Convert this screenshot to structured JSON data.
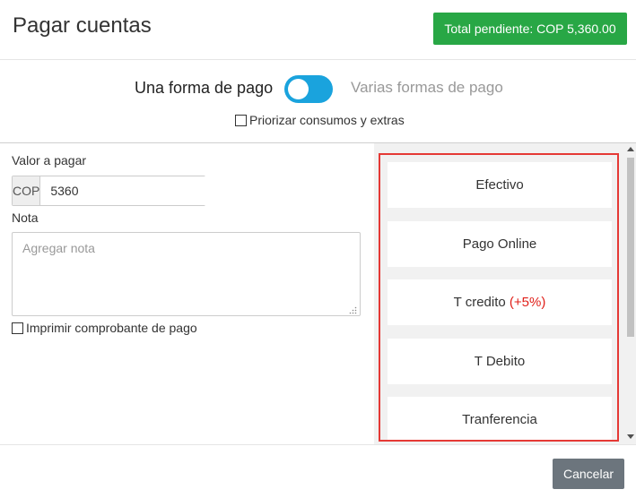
{
  "header": {
    "title": "Pagar cuentas",
    "total_pending": "Total pendiente: COP 5,360.00"
  },
  "payment_mode": {
    "single_label": "Una forma de pago",
    "multiple_label": "Varias formas de pago",
    "prioritize_label": "Priorizar consumos y extras"
  },
  "form": {
    "amount_label": "Valor a pagar",
    "currency": "COP",
    "amount_value": "5360",
    "note_label": "Nota",
    "note_placeholder": "Agregar nota",
    "print_label": "Imprimir comprobante de pago"
  },
  "methods": {
    "efectivo": "Efectivo",
    "pago_online": "Pago Online",
    "t_credito": "T credito",
    "t_credito_surcharge": "(+5%)",
    "t_debito": "T Debito",
    "transferencia": "Tranferencia"
  },
  "footer": {
    "cancel_label": "Cancelar"
  },
  "colors": {
    "total_badge": "#28a745",
    "toggle": "#1aa3dd",
    "methods_border": "#e53935",
    "surcharge": "#e0201a",
    "cancel_button": "#6c757d"
  },
  "icons": {
    "toggle": "toggle-switch",
    "resize": "resize-grip-icon"
  }
}
